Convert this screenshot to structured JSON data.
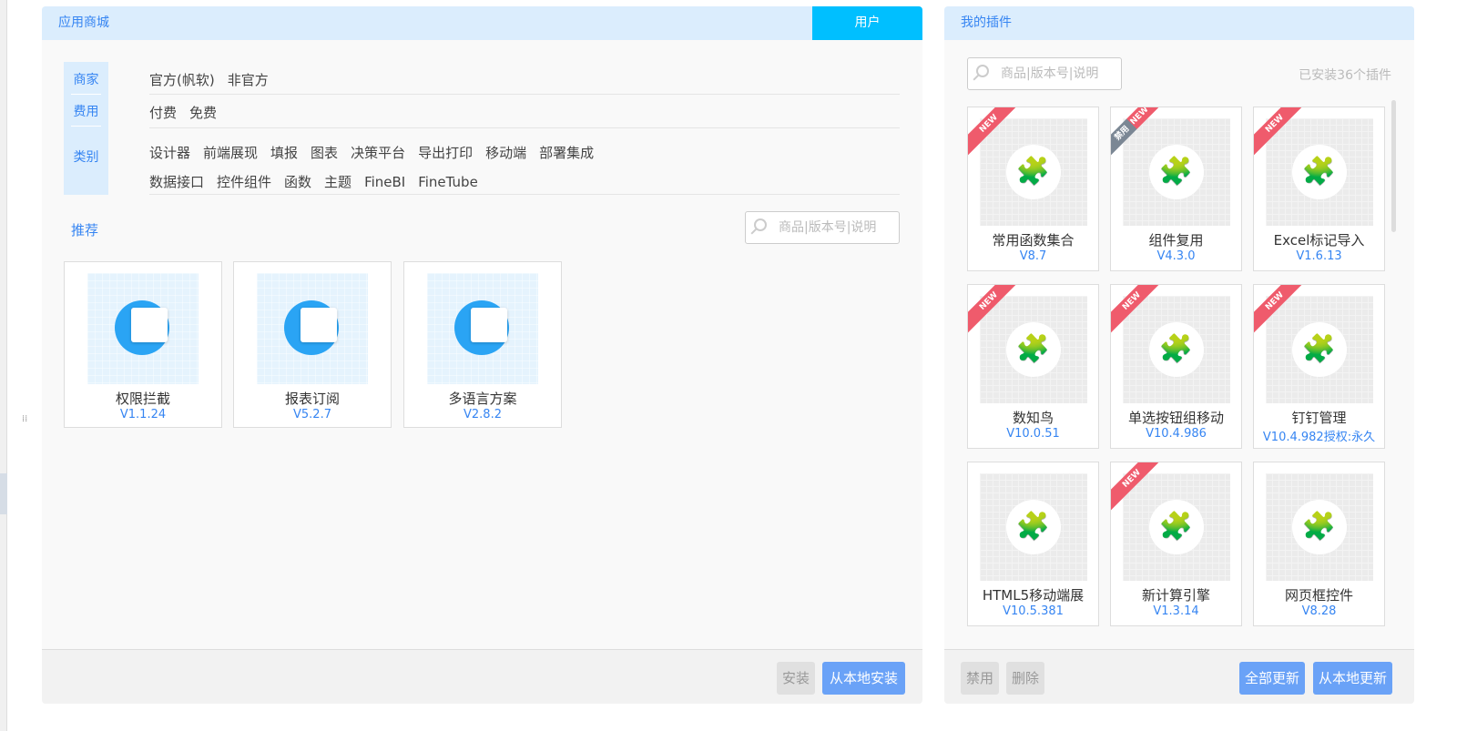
{
  "store": {
    "title": "应用商城",
    "user_tab": "用户",
    "filters": {
      "labels": [
        "商家",
        "费用",
        "类别"
      ],
      "vendor": [
        "官方(帆软)",
        "非官方"
      ],
      "fee": [
        "付费",
        "免费"
      ],
      "category_row1": [
        "设计器",
        "前端展现",
        "填报",
        "图表",
        "决策平台",
        "导出打印",
        "移动端",
        "部署集成"
      ],
      "category_row2": [
        "数据接口",
        "控件组件",
        "函数",
        "主题",
        "FineBI",
        "FineTube"
      ]
    },
    "recommend_label": "推荐",
    "search_placeholder": "商品|版本号|说明",
    "recommended": [
      {
        "name": "权限拦截",
        "version": "V1.1.24"
      },
      {
        "name": "报表订阅",
        "version": "V5.2.7"
      },
      {
        "name": "多语言方案",
        "version": "V2.8.2"
      }
    ],
    "install": "安装",
    "install_local": "从本地安装"
  },
  "mine": {
    "title": "我的插件",
    "search_placeholder": "商品|版本号|说明",
    "installed_count": "已安装36个插件",
    "plugins": [
      {
        "name": "常用函数集合",
        "version": "V8.7",
        "badge": "NEW"
      },
      {
        "name": "组件复用",
        "version": "V4.3.0",
        "badge": "NEW",
        "disabled_label": "禁用"
      },
      {
        "name": "Excel标记导入",
        "version": "V1.6.13",
        "badge": "NEW"
      },
      {
        "name": "数知鸟",
        "version": "V10.0.51",
        "badge": "NEW"
      },
      {
        "name": "单选按钮组移动",
        "version": "V10.4.986",
        "badge": "NEW"
      },
      {
        "name": "钉钉管理",
        "version": "V10.4.982授权:永久",
        "badge": "NEW"
      },
      {
        "name": "HTML5移动端展",
        "version": "V10.5.381",
        "badge": ""
      },
      {
        "name": "新计算引擎",
        "version": "V1.3.14",
        "badge": "NEW"
      },
      {
        "name": "网页框控件",
        "version": "V8.28",
        "badge": ""
      }
    ],
    "disable": "禁用",
    "delete": "删除",
    "update_all": "全部更新",
    "update_local": "从本地更新"
  }
}
